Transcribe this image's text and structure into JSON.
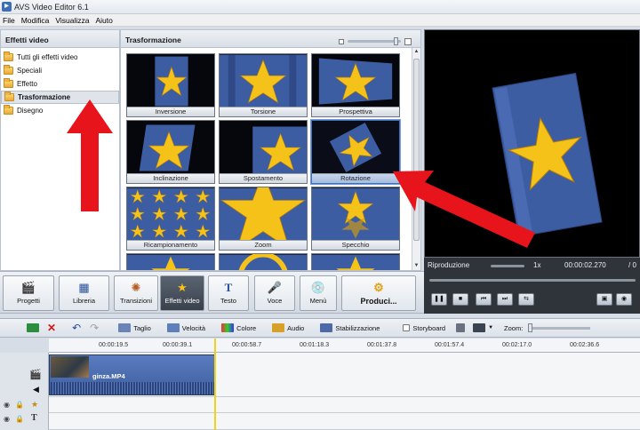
{
  "window": {
    "title": "AVS Video Editor 6.1"
  },
  "menu": [
    "File",
    "Modifica",
    "Visualizza",
    "Aiuto"
  ],
  "left_panel": {
    "header": "Effetti video",
    "items": [
      {
        "label": "Tutti gli effetti video"
      },
      {
        "label": "Speciali"
      },
      {
        "label": "Effetto"
      },
      {
        "label": "Trasformazione"
      },
      {
        "label": "Disegno"
      }
    ],
    "selected": "Trasformazione"
  },
  "grid_panel": {
    "header": "Trasformazione",
    "effects": [
      {
        "label": "Inversione"
      },
      {
        "label": "Torsione"
      },
      {
        "label": "Prospettiva"
      },
      {
        "label": "Inclinazione"
      },
      {
        "label": "Spostamento"
      },
      {
        "label": "Rotazione"
      },
      {
        "label": "Ricampionamento"
      },
      {
        "label": "Zoom"
      },
      {
        "label": "Specchio"
      }
    ],
    "selected": "Rotazione"
  },
  "preview": {
    "label": "Riproduzione",
    "speed": "1x",
    "time": "00:00:02.270",
    "time_sep": "/ 0"
  },
  "main_toolbar": {
    "progetti": "Progetti",
    "libreria": "Libreria",
    "transizioni": "Transizioni",
    "effetti_video": "Effetti video",
    "testo": "Testo",
    "voce": "Voce",
    "menu": "Menù",
    "produci": "Produci..."
  },
  "timeline_toolbar": {
    "taglio": "Taglio",
    "velocita": "Velocità",
    "colore": "Colore",
    "audio": "Audio",
    "stabilizzazione": "Stabilizzazione",
    "storyboard": "Storyboard",
    "zoom": "Zoom:"
  },
  "ruler": [
    "00:00:19.5",
    "00:00:39.1",
    "00:00:58.7",
    "00:01:18.3",
    "00:01:37.8",
    "00:01:57.4",
    "00:02:17.0",
    "00:02:36.6"
  ],
  "clip": {
    "name": "ginza.MP4"
  },
  "colors": {
    "star": "#f5c21a",
    "panel_blue": "#3d5da3",
    "arrow": "#e8141c",
    "selection": "#6f9ce0"
  }
}
